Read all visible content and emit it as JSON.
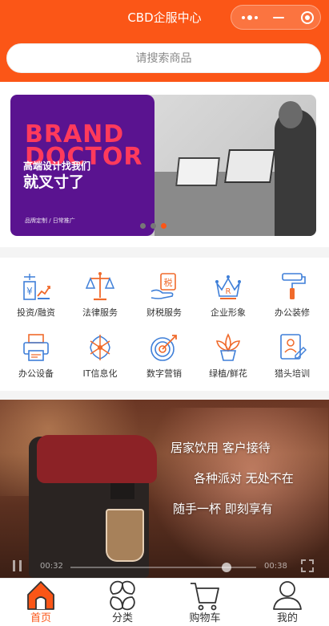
{
  "header": {
    "title": "CBD企服中心",
    "capsule": {
      "more_icon": "more-dots-icon",
      "minimize_icon": "minimize-icon",
      "close_icon": "target-close-icon"
    }
  },
  "search": {
    "placeholder": "请搜索商品"
  },
  "banner": {
    "headline": "BRAND\nDOCTOR",
    "subtitle_line1": "高端设计找我们",
    "subtitle_line2": "就叉寸了",
    "footer": "品牌定制 / 日常推广",
    "slide_count": 3,
    "active_slide": 3
  },
  "categories": [
    {
      "label": "投资/融资",
      "icon": "finance-chart-icon"
    },
    {
      "label": "法律服务",
      "icon": "scales-icon"
    },
    {
      "label": "财税服务",
      "icon": "tax-hand-icon"
    },
    {
      "label": "企业形象",
      "icon": "crown-brand-icon"
    },
    {
      "label": "办公装修",
      "icon": "paint-roller-icon"
    },
    {
      "label": "办公设备",
      "icon": "printer-icon"
    },
    {
      "label": "IT信息化",
      "icon": "network-icon"
    },
    {
      "label": "数字营销",
      "icon": "target-arrow-icon"
    },
    {
      "label": "绿植/鲜花",
      "icon": "potted-plant-icon"
    },
    {
      "label": "猎头培训",
      "icon": "resume-icon"
    }
  ],
  "video": {
    "caption1": "居家饮用  客户接待",
    "caption2": "各种派对  无处不在",
    "caption3": "随手一杯  即刻享有",
    "current_time": "00:32",
    "duration": "00:38",
    "progress": 0.84
  },
  "tabbar": {
    "tabs": [
      {
        "label": "首页",
        "icon": "home-icon",
        "active": true
      },
      {
        "label": "分类",
        "icon": "category-icon",
        "active": false
      },
      {
        "label": "购物车",
        "icon": "cart-icon",
        "active": false
      },
      {
        "label": "我的",
        "icon": "user-icon",
        "active": false
      }
    ]
  },
  "colors": {
    "accent": "#fb5617",
    "icon_blue": "#3f7fd8",
    "icon_orange": "#f06a2b"
  }
}
